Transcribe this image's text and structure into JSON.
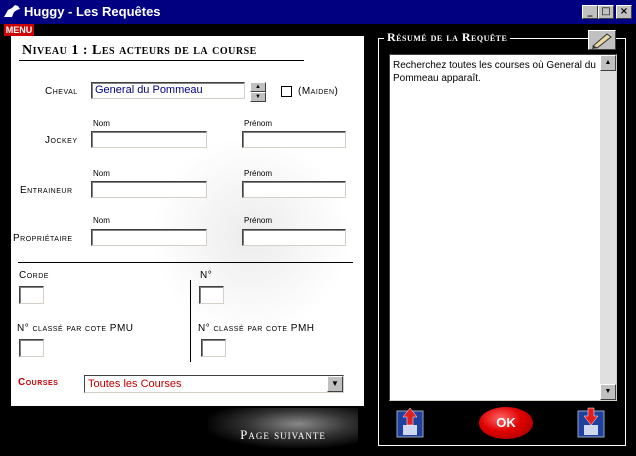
{
  "window": {
    "title": "Huggy - Les Requêtes",
    "minimize_glyph": "_",
    "maximize_glyph": "□",
    "close_glyph": "×"
  },
  "menu": {
    "label": "MENU"
  },
  "level_section": {
    "title": "Niveau 1 : Les acteurs de la course",
    "cheval": {
      "label": "Cheval",
      "value": "General du Pommeau",
      "maiden_label": "(Maiden)",
      "maiden_checked": false
    },
    "jockey": {
      "label": "Jockey",
      "nom_label": "Nom",
      "prenom_label": "Prénom",
      "nom_value": "",
      "prenom_value": ""
    },
    "entraineur": {
      "label": "Entraineur",
      "nom_label": "Nom",
      "prenom_label": "Prénom",
      "nom_value": "",
      "prenom_value": ""
    },
    "proprietaire": {
      "label": "Propriétaire",
      "nom_label": "Nom",
      "prenom_label": "Prénom",
      "nom_value": "",
      "prenom_value": ""
    },
    "corde": {
      "label": "Corde",
      "value": ""
    },
    "numero": {
      "label": "N°",
      "value": ""
    },
    "classe_pmu": {
      "label": "N° classé par cote PMU",
      "value": ""
    },
    "classe_pmh": {
      "label": "N° classé par cote PMH",
      "value": ""
    },
    "courses": {
      "label": "Courses",
      "selected": "Toutes les Courses"
    }
  },
  "next_button": {
    "label": "Page suivante"
  },
  "summary": {
    "title": "Résumé de la Requête",
    "text": "Recherchez toutes les courses où General du Pommeau apparaît."
  },
  "ok_button": {
    "label": "OK"
  },
  "icons": {
    "save": "save-upload-icon",
    "load": "load-download-icon",
    "edit": "pencil-icon"
  },
  "colors": {
    "titlebar": "#000080",
    "accent_red": "#c00000"
  }
}
